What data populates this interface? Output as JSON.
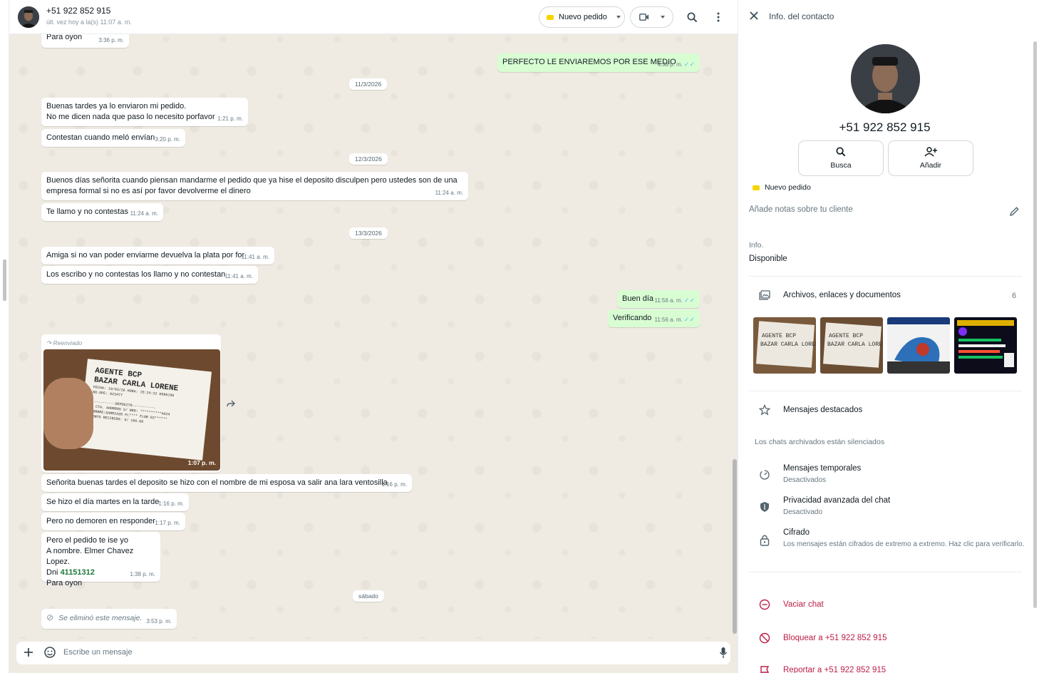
{
  "chat": {
    "contact_name": "+51 922 852 915",
    "last_seen": "últ. vez hoy a la(s) 11:07 a. m.",
    "label_pill": "Nuevo pedido",
    "composer_placeholder": "Escribe un mensaje"
  },
  "messages": {
    "m0": {
      "text": "Para oyon",
      "time": "3:36 p. m."
    },
    "m1": {
      "text": "PERFECTO LE ENVIAREMOS POR ESE MEDIO",
      "time": "4:38 p. m."
    },
    "d1": "11/3/2026",
    "m2": {
      "line1": "Buenas tardes ya lo enviaron mi pedido.",
      "line2": "No me dicen nada  que paso lo necesito  porfavor",
      "time": "1:21 p. m."
    },
    "m3": {
      "text": "Contestan cuando meló envían",
      "time": "3:20 p. m."
    },
    "d2": "12/3/2026",
    "m4": {
      "line1": "Buenos días señorita cuando piensan mandarme el pedido que ya hise el deposito disculpen pero ustedes son de una",
      "line2": "empresa formal si no es así por favor devolverme el dinero",
      "time": "11:24 a. m."
    },
    "m5": {
      "text": "Te llamo y no contestas",
      "time": "11:24 a. m."
    },
    "d3": "13/3/2026",
    "m6": {
      "text": "Amiga si no van poder enviarme devuelva la plata por for",
      "time": "11:41 a. m."
    },
    "m7": {
      "text": "Los escribo y no contestas los llamo y no contestan",
      "time": "11:41 a. m."
    },
    "m8": {
      "text": "Buen día",
      "time": "11:56 a. m."
    },
    "m9": {
      "text": "Verificando",
      "time": "11:56 a. m."
    },
    "img": {
      "forwarded": "Reenviado",
      "time": "1:07 p. m.",
      "r1": "AGENTE BCP",
      "r2": "BAZAR CARLA LORENE",
      "r3": "FECHA: 10/03/26 HORA: 15:24:22   H986190",
      "r4": "NO.OPE: 023477",
      "r5": "-----------DEPOSITO-----------",
      "r6": "A CTA. AHORROS S/   NRO: **********4024",
      "r7": "NOMBRE:GARRIAZO FL**** FLOR ES******",
      "r8": "MONTO RECIBIDO:          S/    100.00"
    },
    "m10": {
      "text": "Señorita buenas tardes el deposito se hizo con el nombre de mi esposa va salir ana lara ventosilla",
      "time": "1:16 p. m."
    },
    "m11": {
      "text": "Se hizo el día martes en la tarde",
      "time": "1:16 p. m."
    },
    "m12": {
      "text": "Pero no demoren en responder",
      "time": "1:17 p. m."
    },
    "m13": {
      "line1": "Pero el pedido te ise yo",
      "line2": "A nombre. Elmer Chavez Lopez.",
      "dni_label": "Dni ",
      "dni": "41151312",
      "line4": "Para  oyon",
      "time": "1:38 p. m."
    },
    "d4": "sábado",
    "m14": {
      "text": "Se eliminó este mensaje.",
      "time": "3:53 p. m."
    }
  },
  "info": {
    "title": "Info. del contacto",
    "phone": "+51 922 852 915",
    "search_label": "Busca",
    "add_label": "Añadir",
    "tag": "Nuevo pedido",
    "notes_placeholder": "Añade notas sobre tu cliente",
    "about_label": "Info.",
    "about_value": "Disponible",
    "media_title": "Archivos, enlaces y documentos",
    "media_count": "6",
    "starred": "Mensajes destacados",
    "archived_note": "Los chats archivados están silenciados",
    "temp_title": "Mensajes temporales",
    "temp_sub": "Desactivados",
    "privacy_title": "Privacidad avanzada del chat",
    "privacy_sub": "Desactivado",
    "encrypt_title": "Cifrado",
    "encrypt_sub": "Los mensajes están cifrados de extremo a extremo. Haz clic para verificarlo.",
    "clear_chat": "Vaciar chat",
    "block": "Bloquear a +51 922 852 915",
    "report": "Reportar a +51 922 852 915"
  },
  "colors": {
    "accent_green": "#d9fdd3",
    "tick_blue": "#53bdeb",
    "danger": "#bb1e46",
    "tag_yellow": "#f7d400"
  },
  "icons": [
    "close-icon",
    "search-icon",
    "add-person-icon",
    "pencil-icon",
    "gallery-icon",
    "star-icon",
    "timer-icon",
    "shield-icon",
    "lock-icon",
    "minus-circle-icon",
    "block-icon",
    "report-icon",
    "plus-icon",
    "sticker-icon",
    "mic-icon",
    "video-icon",
    "menu-icon",
    "forward-icon"
  ]
}
